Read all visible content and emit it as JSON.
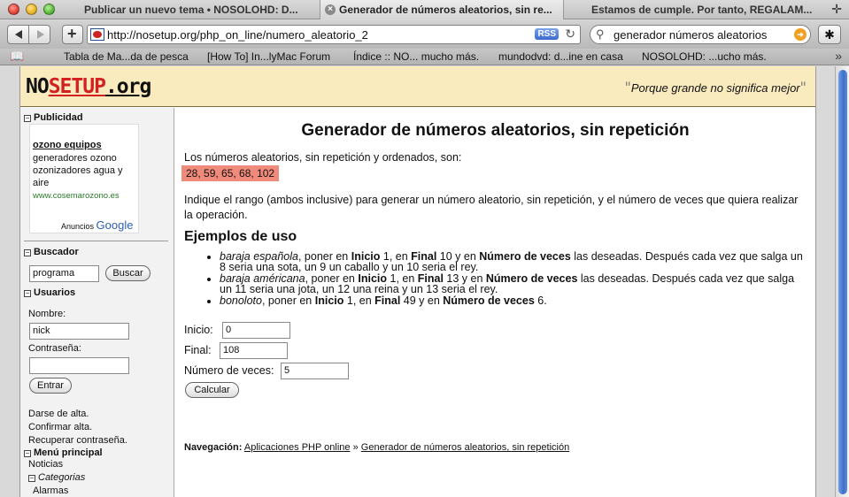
{
  "tabs": [
    {
      "label": "Publicar un nuevo tema • NOSOLOHD: D..."
    },
    {
      "label": "Generador de números aleatorios, sin re..."
    },
    {
      "label": "Estamos de cumple. Por tanto, REGALAM..."
    }
  ],
  "toolbar": {
    "url": "http://nosetup.org/php_on_line/numero_aleatorio_2",
    "rss_label": "RSS",
    "search_value": "generador números aleatorios"
  },
  "bookmarks": [
    {
      "label": "Tabla de Ma...da de pesca"
    },
    {
      "label": "[How To] In...lyMac Forum"
    },
    {
      "label": "Índice :: NO... mucho más."
    },
    {
      "label": "mundodvd: d...ine en casa"
    },
    {
      "label": "NOSOLOHD: ...ucho más."
    }
  ],
  "site": {
    "logo_a": "NO",
    "logo_b": "SETUP",
    "logo_c": ".org",
    "tagline": "Porque grande no significa mejor"
  },
  "sidebar": {
    "publicidad_title": "Publicidad",
    "ad": {
      "title": "ozono equipos",
      "text": "generadores ozono ozonizadores agua y aire",
      "url": "www.cosemarozono.es",
      "footer_a": "Anuncios",
      "footer_b": "Google"
    },
    "buscador_title": "Buscador",
    "search_value": "programa",
    "search_button": "Buscar",
    "usuarios_title": "Usuarios",
    "nombre_label": "Nombre:",
    "nombre_value": "nick",
    "password_label": "Contraseña:",
    "login_button": "Entrar",
    "links": [
      "Darse de alta.",
      "Confirmar alta.",
      "Recuperar contraseña."
    ],
    "menu_title": "Menú principal",
    "menu_items": [
      "Noticias"
    ],
    "categorias_label": "Categorias",
    "categorias_items": [
      "Alarmas"
    ]
  },
  "main": {
    "title": "Generador de números aleatorios, sin repetición",
    "intro": "Los números aleatorios, sin repetición y ordenados, son:",
    "result": "28, 59, 65, 68, 102",
    "instructions": "Indique el rango (ambos inclusive) para generar un número aleatorio, sin repetición, y el número de veces que quiera realizar la operación.",
    "examples_title": "Ejemplos de uso",
    "form": {
      "inicio_label": "Inicio:",
      "inicio_value": "0",
      "final_label": "Final:",
      "final_value": "108",
      "veces_label": "Número de veces:",
      "veces_value": "5",
      "submit_label": "Calcular"
    },
    "nav": {
      "prefix": "Navegación:",
      "crumb1": "Aplicaciones PHP online",
      "separator": "»",
      "crumb2": "Generador de números aleatorios, sin repetición"
    }
  }
}
